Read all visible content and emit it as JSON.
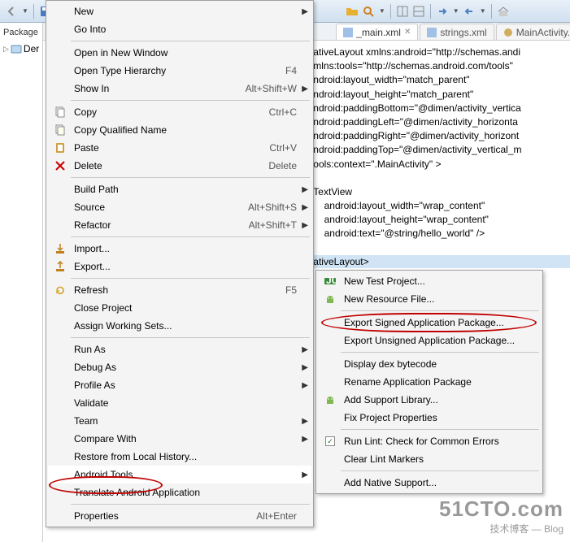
{
  "toolbar": {
    "visible": true
  },
  "sidebar": {
    "header": "Package",
    "tree_root": "Der"
  },
  "tabs": [
    {
      "label": "_main.xml",
      "active": true,
      "icon": "xml"
    },
    {
      "label": "strings.xml",
      "active": false,
      "icon": "xml"
    },
    {
      "label": "MainActivity.java",
      "active": false,
      "icon": "java"
    }
  ],
  "code_lines": [
    "ativeLayout xmlns:android=\"http://schemas.andi",
    "mlns:tools=\"http://schemas.android.com/tools\"",
    "ndroid:layout_width=\"match_parent\"",
    "ndroid:layout_height=\"match_parent\"",
    "ndroid:paddingBottom=\"@dimen/activity_vertica",
    "ndroid:paddingLeft=\"@dimen/activity_horizonta",
    "ndroid:paddingRight=\"@dimen/activity_horizont",
    "ndroid:paddingTop=\"@dimen/activity_vertical_m",
    "ools:context=\".MainActivity\" >",
    "",
    "TextView",
    "    android:layout_width=\"wrap_content\"",
    "    android:layout_height=\"wrap_content\"",
    "    android:text=\"@string/hello_world\" />",
    "",
    "ativeLayout>"
  ],
  "menu1": [
    {
      "type": "item",
      "label": "New",
      "arrow": true
    },
    {
      "type": "item",
      "label": "Go Into"
    },
    {
      "type": "sep"
    },
    {
      "type": "item",
      "label": "Open in New Window"
    },
    {
      "type": "item",
      "label": "Open Type Hierarchy",
      "shortcut": "F4"
    },
    {
      "type": "item",
      "label": "Show In",
      "shortcut": "Alt+Shift+W",
      "arrow": true
    },
    {
      "type": "sep"
    },
    {
      "type": "item",
      "label": "Copy",
      "shortcut": "Ctrl+C",
      "icon": "copy"
    },
    {
      "type": "item",
      "label": "Copy Qualified Name",
      "icon": "copy-q"
    },
    {
      "type": "item",
      "label": "Paste",
      "shortcut": "Ctrl+V",
      "icon": "paste"
    },
    {
      "type": "item",
      "label": "Delete",
      "shortcut": "Delete",
      "icon": "delete"
    },
    {
      "type": "sep"
    },
    {
      "type": "item",
      "label": "Build Path",
      "arrow": true
    },
    {
      "type": "item",
      "label": "Source",
      "shortcut": "Alt+Shift+S",
      "arrow": true
    },
    {
      "type": "item",
      "label": "Refactor",
      "shortcut": "Alt+Shift+T",
      "arrow": true
    },
    {
      "type": "sep"
    },
    {
      "type": "item",
      "label": "Import...",
      "icon": "import"
    },
    {
      "type": "item",
      "label": "Export...",
      "icon": "export"
    },
    {
      "type": "sep"
    },
    {
      "type": "item",
      "label": "Refresh",
      "shortcut": "F5",
      "icon": "refresh"
    },
    {
      "type": "item",
      "label": "Close Project"
    },
    {
      "type": "item",
      "label": "Assign Working Sets..."
    },
    {
      "type": "sep"
    },
    {
      "type": "item",
      "label": "Run As",
      "arrow": true
    },
    {
      "type": "item",
      "label": "Debug As",
      "arrow": true
    },
    {
      "type": "item",
      "label": "Profile As",
      "arrow": true
    },
    {
      "type": "item",
      "label": "Validate"
    },
    {
      "type": "item",
      "label": "Team",
      "arrow": true
    },
    {
      "type": "item",
      "label": "Compare With",
      "arrow": true
    },
    {
      "type": "item",
      "label": "Restore from Local History..."
    },
    {
      "type": "item",
      "label": "Android Tools",
      "arrow": true,
      "highlight": true
    },
    {
      "type": "item",
      "label": "Translate Android Application"
    },
    {
      "type": "sep"
    },
    {
      "type": "item",
      "label": "Properties",
      "shortcut": "Alt+Enter"
    }
  ],
  "menu2": [
    {
      "type": "item",
      "label": "New Test Project...",
      "icon": "junit"
    },
    {
      "type": "item",
      "label": "New Resource File...",
      "icon": "android"
    },
    {
      "type": "sep"
    },
    {
      "type": "item",
      "label": "Export Signed Application Package..."
    },
    {
      "type": "item",
      "label": "Export Unsigned Application Package..."
    },
    {
      "type": "sep"
    },
    {
      "type": "item",
      "label": "Display dex bytecode"
    },
    {
      "type": "item",
      "label": "Rename Application Package"
    },
    {
      "type": "item",
      "label": "Add Support Library...",
      "icon": "android"
    },
    {
      "type": "item",
      "label": "Fix Project Properties"
    },
    {
      "type": "sep"
    },
    {
      "type": "item",
      "label": "Run Lint: Check for Common Errors",
      "icon": "check"
    },
    {
      "type": "item",
      "label": "Clear Lint Markers"
    },
    {
      "type": "sep"
    },
    {
      "type": "item",
      "label": "Add Native Support..."
    }
  ],
  "watermark": {
    "big": "51CTO.com",
    "small": "技术博客 — Blog"
  }
}
